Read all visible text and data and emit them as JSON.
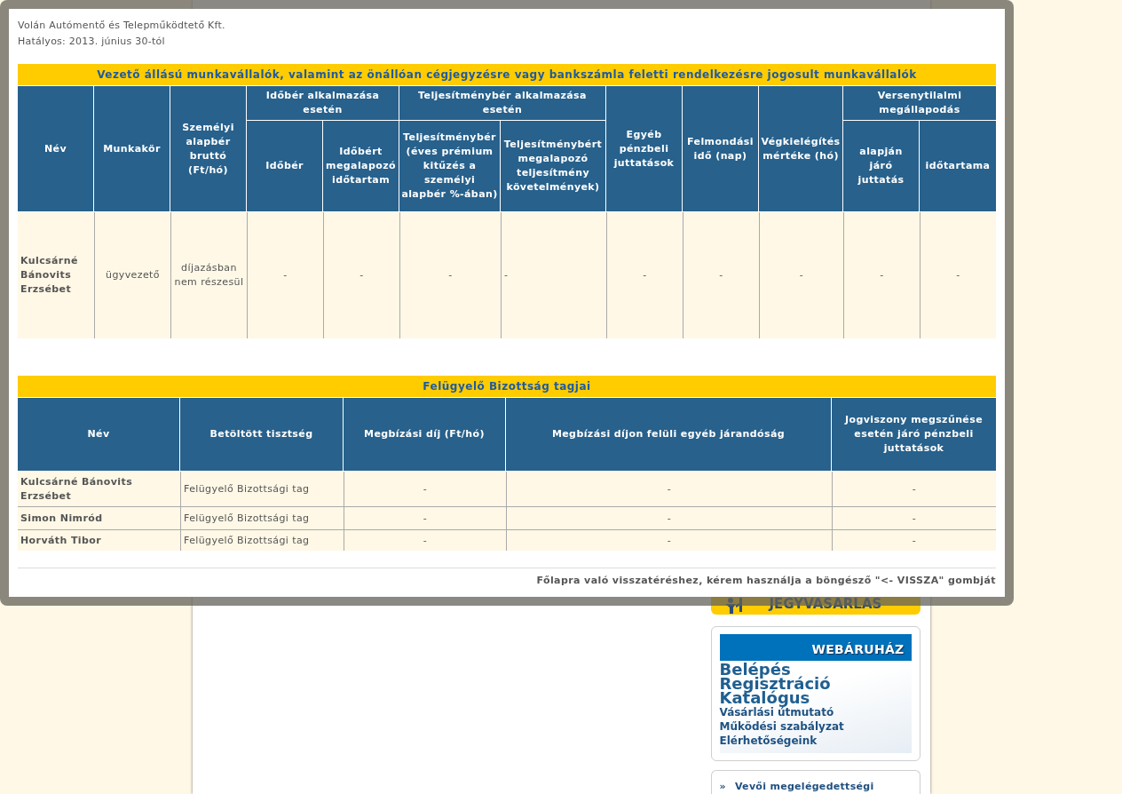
{
  "modal": {
    "company": "Volán Autómentő és Telepműködtető Kft.",
    "effective": "Hatályos: 2013. június 30-tól",
    "executives": {
      "title": "Vezető állású munkavállalók, valamint az önállóan cégjegyzésre vagy bankszámla feletti rendelkezésre jogosult munkavállalók",
      "columns": [
        {
          "label": "Név"
        },
        {
          "label": "Munkakör"
        },
        {
          "label": "Személyi alapbér bruttó (Ft/hó)"
        },
        {
          "label": "Időbér alkalmazása esetén",
          "colspan": 2,
          "children": [
            {
              "label": "Időbér"
            },
            {
              "label": "Időbért megalapozó időtartam"
            }
          ]
        },
        {
          "label": "Teljesítménybér alkalmazása esetén",
          "colspan": 2,
          "children": [
            {
              "label": "Teljesítménybér (éves prémium kitűzés a személyi alapbér %-ában)"
            },
            {
              "label": "Teljesítménybért megalapozó teljesítmény követelmények)"
            }
          ]
        },
        {
          "label": "Egyéb pénzbeli juttatások"
        },
        {
          "label": "Felmondási idő (nap)"
        },
        {
          "label": "Végkielégítés mértéke (hó)"
        },
        {
          "label": "Versenytilalmi megállapodás",
          "colspan": 2,
          "children": [
            {
              "label": "alapján járó juttatás"
            },
            {
              "label": "időtartama"
            }
          ]
        }
      ],
      "rows": [
        [
          "Kulcsárné Bánovits Erzsébet",
          "ügyvezető",
          "díjazásban nem részesül",
          "-",
          "-",
          "-",
          "-",
          "-",
          "-",
          "-",
          "-",
          "-"
        ]
      ]
    },
    "board": {
      "title": "Felügyelő Bizottság tagjai",
      "columns": [
        "Név",
        "Betöltött tisztség",
        "Megbízási díj (Ft/hó)",
        "Megbízási díjon felüli egyéb járandóság",
        "Jogviszony megszűnése esetén járó pénzbeli juttatások"
      ],
      "rows": [
        [
          "Kulcsárné Bánovits Erzsébet",
          "Felügyelő Bizottsági tag",
          "-",
          "-",
          "-"
        ],
        [
          "Simon Nimród",
          "Felügyelő Bizottsági tag",
          "-",
          "-",
          "-"
        ],
        [
          "Horváth Tibor",
          "Felügyelő Bizottsági tag",
          "-",
          "-",
          "-"
        ]
      ]
    },
    "footer_note": "Főlapra való visszatéréshez, kérem használja a böngésző \"<- VISSZA\" gombját"
  },
  "sidebar": {
    "ticket_banner": {
      "label": "JEGYVASARLAS"
    },
    "webshop": {
      "title": "WEBÁRUHÁZ",
      "main_links": [
        "Belépés",
        "Regisztráció",
        "Katalógus"
      ],
      "links": [
        "Vásárlási útmutató",
        "Működési szabályzat",
        "Elérhetőségeink"
      ]
    },
    "survey_box": {
      "bullet": "»",
      "link": "Vevői megelégedettségi"
    }
  }
}
